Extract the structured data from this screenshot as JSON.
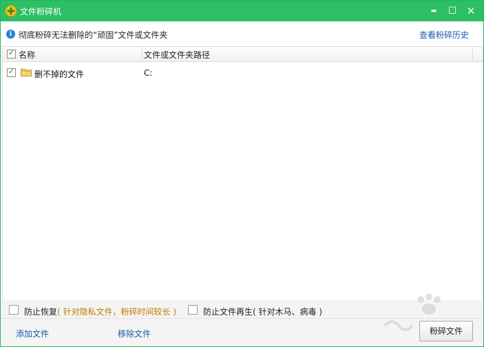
{
  "window": {
    "title": "文件粉碎机",
    "min_symbol": "▬",
    "max_symbol": "☐",
    "close_symbol": "✕"
  },
  "info": {
    "icon_glyph": "i",
    "text": "彻底粉碎无法删除的“顽固”文件或文件夹",
    "history_link": "查看粉碎历史"
  },
  "table": {
    "columns": [
      "名称",
      "文件或文件夹路径"
    ],
    "rows": [
      {
        "name": "删不掉的文件",
        "path": "C:",
        "checked": true
      }
    ]
  },
  "options": {
    "prevent_recovery_label": "防止恢复",
    "prevent_recovery_note": "( 针对隐私文件，粉碎时间较长 )",
    "prevent_regen_label": "防止文件再生",
    "prevent_regen_note": "( 针对木马、病毒 )"
  },
  "footer": {
    "add_file": "添加文件",
    "remove_file": "移除文件",
    "shred_button": "粉碎文件"
  },
  "colors": {
    "titlebar": "#2dbf63",
    "link": "#1a5aa8",
    "note": "#c07a00"
  }
}
